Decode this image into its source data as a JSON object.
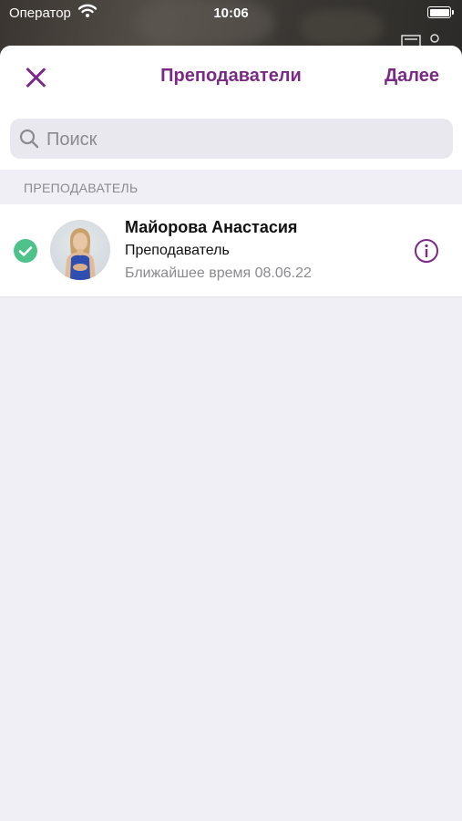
{
  "status_bar": {
    "carrier": "Оператор",
    "time": "10:06"
  },
  "nav": {
    "title": "Преподаватели",
    "next_label": "Далее"
  },
  "search": {
    "placeholder": "Поиск",
    "value": ""
  },
  "section": {
    "header": "ПРЕПОДАВАТЕЛЬ"
  },
  "teachers": [
    {
      "name": "Майорова Анастасия",
      "role": "Преподаватель",
      "next_time": "Ближайшее время 08.06.22",
      "selected": true
    }
  ],
  "colors": {
    "accent": "#7a2a85",
    "check": "#4fc18b",
    "background": "#f0eff5"
  },
  "icons": [
    "wifi-icon",
    "battery-icon",
    "close-icon",
    "search-icon",
    "checkmark-icon",
    "info-icon"
  ]
}
